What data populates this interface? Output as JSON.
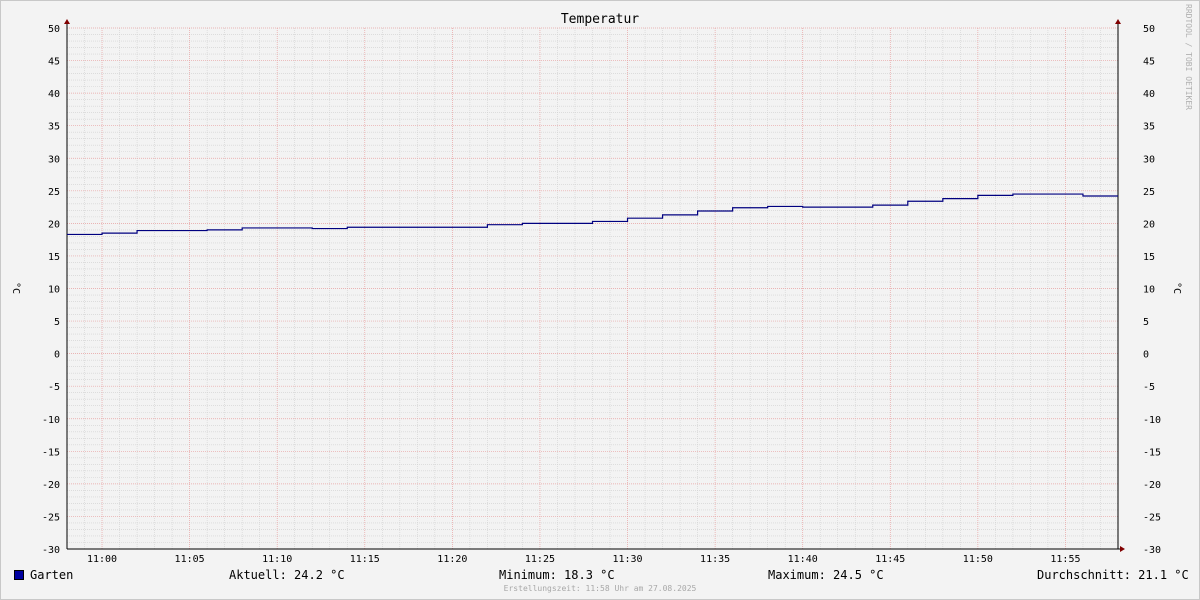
{
  "watermark": "RRDTOOL / TOBI OETIKER",
  "footer": "Erstellungszeit: 11:58 Uhr am 27.08.2025",
  "legend": {
    "series_name": "Garten",
    "current": "Aktuell: 24.2 °C",
    "minimum": "Minimum: 18.3 °C",
    "maximum": "Maximum: 24.5 °C",
    "average": "Durchschnitt: 21.1 °C"
  },
  "colors": {
    "line": "#000080",
    "swatch": "#0000a0",
    "major_grid": "#e8a0a0",
    "minor_grid": "#d0d0d0",
    "axis": "#800000"
  },
  "chart_data": {
    "type": "line",
    "title": "Temperatur",
    "ylabel": "°C",
    "ylabel_right": "°C",
    "ylim": [
      -30,
      50
    ],
    "yticks": [
      50,
      45,
      40,
      35,
      30,
      25,
      20,
      15,
      10,
      5,
      0,
      -5,
      -10,
      -15,
      -20,
      -25,
      -30
    ],
    "xlim": [
      "10:58",
      "11:58"
    ],
    "xticks": [
      "11:00",
      "11:05",
      "11:10",
      "11:15",
      "11:20",
      "11:25",
      "11:30",
      "11:35",
      "11:40",
      "11:45",
      "11:50",
      "11:55"
    ],
    "grid": true,
    "step": true,
    "series": [
      {
        "name": "Garten",
        "x": [
          "10:58",
          "11:00",
          "11:02",
          "11:04",
          "11:06",
          "11:08",
          "11:10",
          "11:12",
          "11:14",
          "11:16",
          "11:18",
          "11:20",
          "11:22",
          "11:24",
          "11:26",
          "11:28",
          "11:30",
          "11:32",
          "11:34",
          "11:36",
          "11:38",
          "11:40",
          "11:42",
          "11:44",
          "11:46",
          "11:48",
          "11:50",
          "11:52",
          "11:54",
          "11:56"
        ],
        "values": [
          18.3,
          18.5,
          18.9,
          18.9,
          19.0,
          19.3,
          19.3,
          19.2,
          19.4,
          19.4,
          19.4,
          19.4,
          19.8,
          20.0,
          20.0,
          20.3,
          20.8,
          21.3,
          21.9,
          22.4,
          22.6,
          22.5,
          22.5,
          22.8,
          23.4,
          23.8,
          24.3,
          24.5,
          24.5,
          24.2
        ]
      }
    ]
  }
}
